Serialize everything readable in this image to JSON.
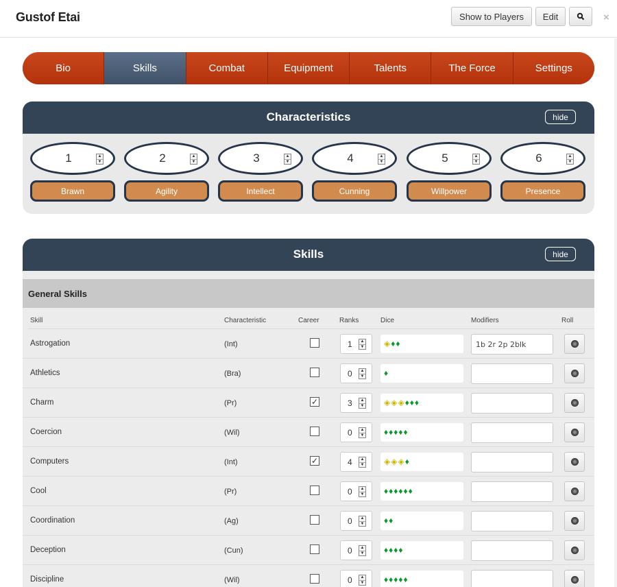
{
  "window": {
    "title": "Gustof Etai",
    "buttons": {
      "show_to_players": "Show to Players",
      "edit": "Edit",
      "search_icon": "magnifier-icon",
      "close": "×"
    }
  },
  "tabs": [
    {
      "label": "Bio",
      "active": false
    },
    {
      "label": "Skills",
      "active": true
    },
    {
      "label": "Combat",
      "active": false
    },
    {
      "label": "Equipment",
      "active": false
    },
    {
      "label": "Talents",
      "active": false
    },
    {
      "label": "The Force",
      "active": false
    },
    {
      "label": "Settings",
      "active": false
    }
  ],
  "characteristics": {
    "title": "Characteristics",
    "hide_label": "hide",
    "items": [
      {
        "value": "1",
        "label": "Brawn"
      },
      {
        "value": "2",
        "label": "Agility"
      },
      {
        "value": "3",
        "label": "Intellect"
      },
      {
        "value": "4",
        "label": "Cunning"
      },
      {
        "value": "5",
        "label": "Willpower"
      },
      {
        "value": "6",
        "label": "Presence"
      }
    ]
  },
  "skills": {
    "title": "Skills",
    "hide_label": "hide",
    "group_title": "General Skills",
    "columns": {
      "skill": "Skill",
      "characteristic": "Characteristic",
      "career": "Career",
      "ranks": "Ranks",
      "dice": "Dice",
      "modifiers": "Modifiers",
      "roll": "Roll"
    },
    "rows": [
      {
        "skill": "Astrogation",
        "characteristic": "(Int)",
        "career": false,
        "ranks": "1",
        "proficiency": 1,
        "ability": 2,
        "modifiers": "1b 2r 2p 2blk"
      },
      {
        "skill": "Athletics",
        "characteristic": "(Bra)",
        "career": false,
        "ranks": "0",
        "proficiency": 0,
        "ability": 1,
        "modifiers": ""
      },
      {
        "skill": "Charm",
        "characteristic": "(Pr)",
        "career": true,
        "ranks": "3",
        "proficiency": 3,
        "ability": 3,
        "modifiers": ""
      },
      {
        "skill": "Coercion",
        "characteristic": "(Wil)",
        "career": false,
        "ranks": "0",
        "proficiency": 0,
        "ability": 5,
        "modifiers": ""
      },
      {
        "skill": "Computers",
        "characteristic": "(Int)",
        "career": true,
        "ranks": "4",
        "proficiency": 3,
        "ability": 1,
        "modifiers": ""
      },
      {
        "skill": "Cool",
        "characteristic": "(Pr)",
        "career": false,
        "ranks": "0",
        "proficiency": 0,
        "ability": 6,
        "modifiers": ""
      },
      {
        "skill": "Coordination",
        "characteristic": "(Ag)",
        "career": false,
        "ranks": "0",
        "proficiency": 0,
        "ability": 2,
        "modifiers": ""
      },
      {
        "skill": "Deception",
        "characteristic": "(Cun)",
        "career": false,
        "ranks": "0",
        "proficiency": 0,
        "ability": 4,
        "modifiers": ""
      },
      {
        "skill": "Discipline",
        "characteristic": "(Wil)",
        "career": false,
        "ranks": "0",
        "proficiency": 0,
        "ability": 5,
        "modifiers": ""
      }
    ]
  },
  "colors": {
    "tab_bg": "#b3320b",
    "tab_active": "#405268",
    "panel_header": "#344457",
    "char_label": "#d18b4e",
    "ability_die": "#0a9a2a",
    "proficiency_die": "#c9b800"
  }
}
